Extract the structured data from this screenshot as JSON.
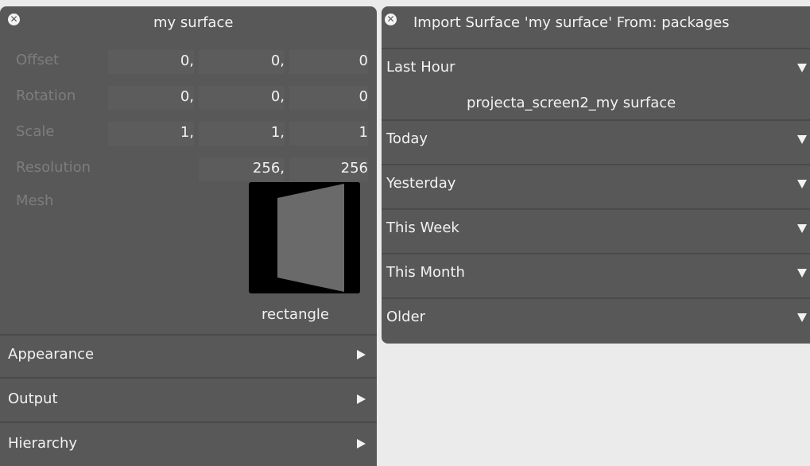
{
  "surface_panel": {
    "title": "my surface",
    "props": {
      "offset": {
        "label": "Offset",
        "x": "0,",
        "y": "0,",
        "z": "0"
      },
      "rotation": {
        "label": "Rotation",
        "x": "0,",
        "y": "0,",
        "z": "0"
      },
      "scale": {
        "label": "Scale",
        "x": "1,",
        "y": "1,",
        "z": "1"
      },
      "resolution": {
        "label": "Resolution",
        "w": "256,",
        "h": "256"
      },
      "mesh": {
        "label": "Mesh",
        "name": "rectangle"
      }
    },
    "sections": {
      "appearance": "Appearance",
      "output": "Output",
      "hierarchy": "Hierarchy"
    }
  },
  "import_panel": {
    "title": "Import Surface 'my surface' From: packages",
    "groups": {
      "last_hour": {
        "label": "Last Hour",
        "items": [
          "projecta_screen2_my surface"
        ]
      },
      "today": {
        "label": "Today"
      },
      "yesterday": {
        "label": "Yesterday"
      },
      "this_week": {
        "label": "This Week"
      },
      "this_month": {
        "label": "This Month"
      },
      "older": {
        "label": "Older"
      }
    }
  }
}
